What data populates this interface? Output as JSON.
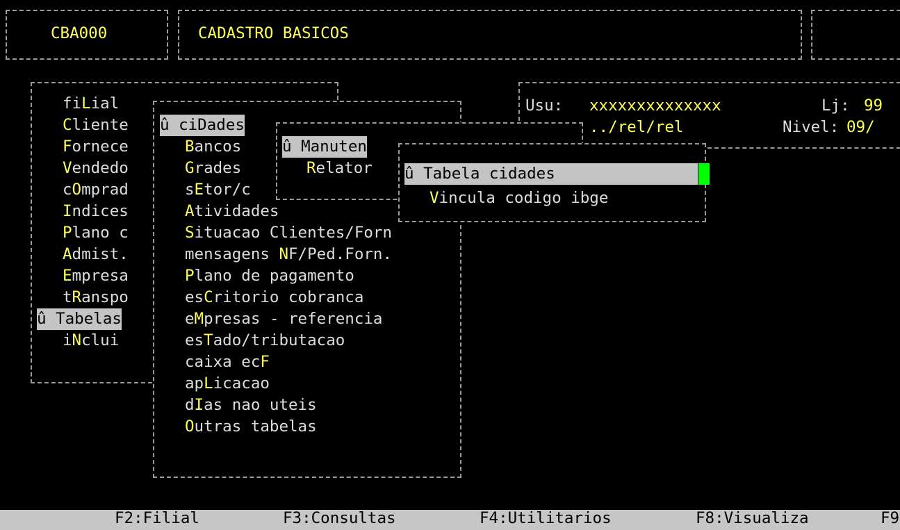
{
  "header": {
    "program_code": "CBA000",
    "title": "CADASTRO BASICOS"
  },
  "info": {
    "user_label": "Usu:",
    "user_value": "xxxxxxxxxxxxxx",
    "store_label": "Lj:",
    "store_value": "99",
    "path": "../rel/rel",
    "level_label": "Nivel:",
    "level_value": "09/"
  },
  "main_menu": {
    "items": [
      {
        "pre": "fi",
        "key": "L",
        "post": "ial"
      },
      {
        "pre": "",
        "key": "C",
        "post": "liente"
      },
      {
        "pre": "",
        "key": "F",
        "post": "ornece"
      },
      {
        "pre": "",
        "key": "V",
        "post": "endedo"
      },
      {
        "pre": "c",
        "key": "O",
        "post": "mprad"
      },
      {
        "pre": "",
        "key": "I",
        "post": "ndices"
      },
      {
        "pre": "",
        "key": "P",
        "post": "lano c"
      },
      {
        "pre": "",
        "key": "A",
        "post": "dmist."
      },
      {
        "pre": "",
        "key": "E",
        "post": "mpresa"
      },
      {
        "pre": "t",
        "key": "R",
        "post": "anspo"
      },
      {
        "label": "û Tabelas"
      },
      {
        "pre": "i",
        "key": "N",
        "post": "clui"
      }
    ]
  },
  "tabelas_menu": {
    "items": [
      {
        "label": "û ciDades"
      },
      {
        "pre": "",
        "key": "B",
        "post": "ancos"
      },
      {
        "pre": "",
        "key": "G",
        "post": "rades"
      },
      {
        "pre": "s",
        "key": "E",
        "post": "tor/c"
      },
      {
        "pre": "",
        "key": "A",
        "post": "tividades"
      },
      {
        "pre": "",
        "key": "S",
        "post": "ituacao Clientes/Forn"
      },
      {
        "pre": "mensagens ",
        "key": "N",
        "post": "F/Ped.Forn."
      },
      {
        "pre": "",
        "key": "P",
        "post": "lano de pagamento"
      },
      {
        "pre": "es",
        "key": "C",
        "post": "ritorio cobranca"
      },
      {
        "pre": "e",
        "key": "M",
        "post": "presas - referencia"
      },
      {
        "pre": "es",
        "key": "T",
        "post": "ado/tributacao"
      },
      {
        "pre": "caixa ec",
        "key": "F",
        "post": ""
      },
      {
        "pre": "ap",
        "key": "L",
        "post": "icacao"
      },
      {
        "pre": "d",
        "key": "I",
        "post": "as nao uteis"
      },
      {
        "pre": "",
        "key": "O",
        "post": "utras tabelas"
      }
    ]
  },
  "cidades_menu": {
    "items": [
      {
        "label": "û Manuten"
      },
      {
        "pre": "",
        "key": "R",
        "post": "elator"
      }
    ]
  },
  "manutencao_menu": {
    "items": [
      {
        "label": "û Tabela cidades"
      },
      {
        "pre": "",
        "key": "V",
        "post": "incula codigo ibge"
      }
    ]
  },
  "function_keys": [
    "F2:Filial",
    "F3:Consultas",
    "F4:Utilitarios",
    "F8:Visualiza",
    "F9"
  ],
  "colors": {
    "background": "#000000",
    "text": "#dcdcdc",
    "hotkey": "#ffff55",
    "highlight": "#c4c4c4",
    "cursor": "#00ff00",
    "status_bar": "#c6c6c6"
  }
}
